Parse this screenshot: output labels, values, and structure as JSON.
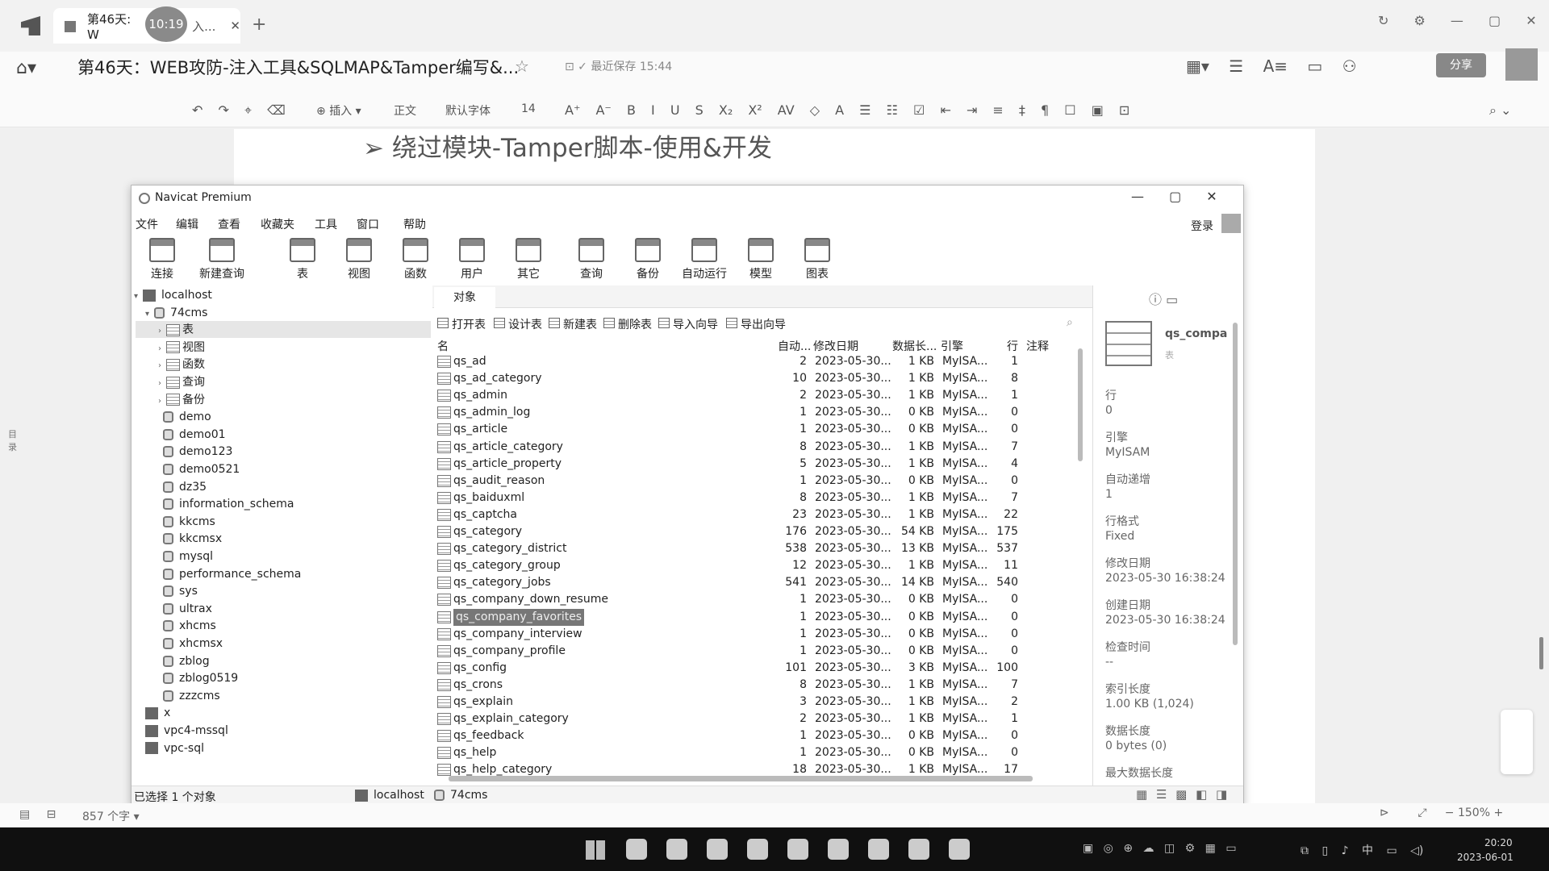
{
  "tabs": {
    "tab_label": "第46天: W",
    "clock": "10:19"
  },
  "doc": {
    "title": "第46天：WEB攻防-注入工具&SQLMAP&Tamper编写&...",
    "saved": "最近保存 15:44",
    "share": "分享",
    "heading": "➢ 绕过模块-Tamper脚本-使用&开发"
  },
  "toolbar": {
    "insert": "插入",
    "style": "正文",
    "font": "默认字体",
    "size": "14"
  },
  "navicat": {
    "title": "Navicat Premium",
    "login": "登录",
    "menus": [
      "文件",
      "编辑",
      "查看",
      "收藏夹",
      "工具",
      "窗口",
      "帮助"
    ],
    "tools": [
      "连接",
      "新建查询",
      "表",
      "视图",
      "函数",
      "用户",
      "其它",
      "查询",
      "备份",
      "自动运行",
      "模型",
      "图表"
    ],
    "tab": "对象",
    "actions": [
      "打开表",
      "设计表",
      "新建表",
      "删除表",
      "导入向导",
      "导出向导"
    ],
    "columns": [
      "名",
      "自动...",
      "修改日期",
      "数据长...",
      "引擎",
      "行",
      "注释"
    ],
    "tree": {
      "server": "localhost",
      "db": "74cms",
      "children": [
        "表",
        "视图",
        "函数",
        "查询",
        "备份"
      ],
      "dbs": [
        "demo",
        "demo01",
        "demo123",
        "demo0521",
        "dz35",
        "information_schema",
        "kkcms",
        "kkcmsx",
        "mysql",
        "performance_schema",
        "sys",
        "ultrax",
        "xhcms",
        "xhcmsx",
        "zblog",
        "zblog0519",
        "zzzcms"
      ],
      "others": [
        "x",
        "vpc4-mssql",
        "vpc-sql"
      ]
    },
    "rows": [
      [
        "qs_ad",
        "2",
        "2023-05-30...",
        "1 KB",
        "MyISA...",
        "1"
      ],
      [
        "qs_ad_category",
        "10",
        "2023-05-30...",
        "1 KB",
        "MyISA...",
        "8"
      ],
      [
        "qs_admin",
        "2",
        "2023-05-30...",
        "1 KB",
        "MyISA...",
        "1"
      ],
      [
        "qs_admin_log",
        "1",
        "2023-05-30...",
        "0 KB",
        "MyISA...",
        "0"
      ],
      [
        "qs_article",
        "1",
        "2023-05-30...",
        "0 KB",
        "MyISA...",
        "0"
      ],
      [
        "qs_article_category",
        "8",
        "2023-05-30...",
        "1 KB",
        "MyISA...",
        "7"
      ],
      [
        "qs_article_property",
        "5",
        "2023-05-30...",
        "1 KB",
        "MyISA...",
        "4"
      ],
      [
        "qs_audit_reason",
        "1",
        "2023-05-30...",
        "0 KB",
        "MyISA...",
        "0"
      ],
      [
        "qs_baiduxml",
        "8",
        "2023-05-30...",
        "1 KB",
        "MyISA...",
        "7"
      ],
      [
        "qs_captcha",
        "23",
        "2023-05-30...",
        "1 KB",
        "MyISA...",
        "22"
      ],
      [
        "qs_category",
        "176",
        "2023-05-30...",
        "54 KB",
        "MyISA...",
        "175"
      ],
      [
        "qs_category_district",
        "538",
        "2023-05-30...",
        "13 KB",
        "MyISA...",
        "537"
      ],
      [
        "qs_category_group",
        "12",
        "2023-05-30...",
        "1 KB",
        "MyISA...",
        "11"
      ],
      [
        "qs_category_jobs",
        "541",
        "2023-05-30...",
        "14 KB",
        "MyISA...",
        "540"
      ],
      [
        "qs_company_down_resume",
        "1",
        "2023-05-30...",
        "0 KB",
        "MyISA...",
        "0"
      ],
      [
        "qs_company_favorites",
        "1",
        "2023-05-30...",
        "0 KB",
        "MyISA...",
        "0"
      ],
      [
        "qs_company_interview",
        "1",
        "2023-05-30...",
        "0 KB",
        "MyISA...",
        "0"
      ],
      [
        "qs_company_profile",
        "1",
        "2023-05-30...",
        "0 KB",
        "MyISA...",
        "0"
      ],
      [
        "qs_config",
        "101",
        "2023-05-30...",
        "3 KB",
        "MyISA...",
        "100"
      ],
      [
        "qs_crons",
        "8",
        "2023-05-30...",
        "1 KB",
        "MyISA...",
        "7"
      ],
      [
        "qs_explain",
        "3",
        "2023-05-30...",
        "1 KB",
        "MyISA...",
        "2"
      ],
      [
        "qs_explain_category",
        "2",
        "2023-05-30...",
        "1 KB",
        "MyISA...",
        "1"
      ],
      [
        "qs_feedback",
        "1",
        "2023-05-30...",
        "0 KB",
        "MyISA...",
        "0"
      ],
      [
        "qs_help",
        "1",
        "2023-05-30...",
        "0 KB",
        "MyISA...",
        "0"
      ],
      [
        "qs_help_category",
        "18",
        "2023-05-30...",
        "1 KB",
        "MyISA...",
        "17"
      ]
    ],
    "info": {
      "name": "qs_compa",
      "sub": "表",
      "fields": [
        [
          "行",
          "0"
        ],
        [
          "引擎",
          "MyISAM"
        ],
        [
          "自动递增",
          "1"
        ],
        [
          "行格式",
          "Fixed"
        ],
        [
          "修改日期",
          "2023-05-30 16:38:24"
        ],
        [
          "创建日期",
          "2023-05-30 16:38:24"
        ],
        [
          "检查时间",
          "--"
        ],
        [
          "索引长度",
          "1.00 KB (1,024)"
        ],
        [
          "数据长度",
          "0 bytes (0)"
        ],
        [
          "最大数据长度",
          ""
        ]
      ]
    },
    "status": {
      "selected": "已选择 1 个对象",
      "server": "localhost",
      "db": "74cms"
    }
  },
  "statusbar": {
    "words": "857 个字",
    "zoom": "150%"
  },
  "taskbar": {
    "time": "20:20",
    "date": "2023-06-01",
    "ime": "中"
  }
}
